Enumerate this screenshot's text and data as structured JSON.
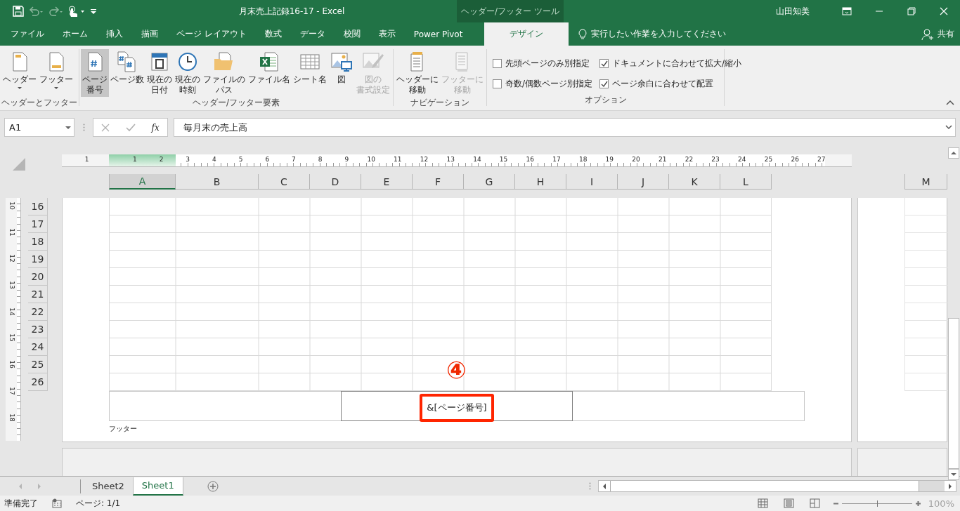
{
  "title_bar": {
    "title": "月末売上記録16-17  -  Excel",
    "context_tools": "ヘッダー/フッター ツール",
    "user": "山田知美"
  },
  "tabs": [
    {
      "label": "ファイル",
      "selected": false
    },
    {
      "label": "ホーム",
      "selected": false
    },
    {
      "label": "挿入",
      "selected": false
    },
    {
      "label": "描画",
      "selected": false
    },
    {
      "label": "ページ レイアウト",
      "selected": false
    },
    {
      "label": "数式",
      "selected": false
    },
    {
      "label": "データ",
      "selected": false
    },
    {
      "label": "校閲",
      "selected": false
    },
    {
      "label": "表示",
      "selected": false
    },
    {
      "label": "Power Pivot",
      "selected": false
    },
    {
      "label": "デザイン",
      "selected": true
    }
  ],
  "tell_me": "実行したい作業を入力してください",
  "share": "共有",
  "ribbon": {
    "groups": [
      {
        "label": "ヘッダーとフッター",
        "buttons": [
          {
            "lines": [
              "ヘッダー"
            ],
            "dropdown": true,
            "selected": false,
            "disabled": false
          },
          {
            "lines": [
              "フッター"
            ],
            "dropdown": true,
            "selected": false,
            "disabled": false
          }
        ]
      },
      {
        "label": "ヘッダー/フッター要素",
        "buttons": [
          {
            "lines": [
              "ページ",
              "番号"
            ],
            "dropdown": false,
            "selected": true,
            "disabled": false
          },
          {
            "lines": [
              "ページ数"
            ],
            "dropdown": false,
            "selected": false,
            "disabled": false
          },
          {
            "lines": [
              "現在の",
              "日付"
            ],
            "dropdown": false,
            "selected": false,
            "disabled": false
          },
          {
            "lines": [
              "現在の",
              "時刻"
            ],
            "dropdown": false,
            "selected": false,
            "disabled": false
          },
          {
            "lines": [
              "ファイルの",
              "パス"
            ],
            "dropdown": false,
            "selected": false,
            "disabled": false
          },
          {
            "lines": [
              "ファイル名"
            ],
            "dropdown": false,
            "selected": false,
            "disabled": false
          },
          {
            "lines": [
              "シート名"
            ],
            "dropdown": false,
            "selected": false,
            "disabled": false
          },
          {
            "lines": [
              "図"
            ],
            "dropdown": false,
            "selected": false,
            "disabled": false
          },
          {
            "lines": [
              "図の",
              "書式設定"
            ],
            "dropdown": false,
            "selected": false,
            "disabled": true
          }
        ]
      },
      {
        "label": "ナビゲーション",
        "buttons": [
          {
            "lines": [
              "ヘッダーに",
              "移動"
            ],
            "dropdown": false,
            "selected": false,
            "disabled": false
          },
          {
            "lines": [
              "フッターに",
              "移動"
            ],
            "dropdown": false,
            "selected": false,
            "disabled": true
          }
        ]
      },
      {
        "label": "オプション",
        "checkboxes": [
          {
            "label": "先頭ページのみ別指定",
            "checked": false
          },
          {
            "label": "奇数/偶数ページ別指定",
            "checked": false
          },
          {
            "label": "ドキュメントに合わせて拡大/縮小",
            "checked": true
          },
          {
            "label": "ページ余白に合わせて配置",
            "checked": true
          }
        ]
      }
    ]
  },
  "formula_bar": {
    "name_box": "A1",
    "function_label": "fx",
    "value": "毎月末の売上高"
  },
  "ruler": {
    "top_labels": [
      "1",
      "1",
      "2",
      "3",
      "4",
      "5",
      "6",
      "7",
      "8",
      "9",
      "10",
      "11",
      "12",
      "13",
      "14",
      "15",
      "16",
      "17",
      "18",
      "19",
      "20",
      "21",
      "22",
      "23",
      "24",
      "25",
      "26",
      "27"
    ],
    "side_labels": [
      "10",
      "11",
      "12",
      "13",
      "14",
      "15",
      "16",
      "17",
      "18"
    ]
  },
  "columns": [
    {
      "label": "A",
      "selected": true
    },
    {
      "label": "B",
      "selected": false
    },
    {
      "label": "C",
      "selected": false
    },
    {
      "label": "D",
      "selected": false
    },
    {
      "label": "E",
      "selected": false
    },
    {
      "label": "F",
      "selected": false
    },
    {
      "label": "G",
      "selected": false
    },
    {
      "label": "H",
      "selected": false
    },
    {
      "label": "I",
      "selected": false
    },
    {
      "label": "J",
      "selected": false
    },
    {
      "label": "K",
      "selected": false
    },
    {
      "label": "L",
      "selected": false
    }
  ],
  "next_page_columns": [
    {
      "label": "M",
      "selected": false
    }
  ],
  "rows": [
    {
      "label": "16"
    },
    {
      "label": "17"
    },
    {
      "label": "18"
    },
    {
      "label": "19"
    },
    {
      "label": "20"
    },
    {
      "label": "21"
    },
    {
      "label": "22"
    },
    {
      "label": "23"
    },
    {
      "label": "24"
    },
    {
      "label": "25"
    },
    {
      "label": "26"
    }
  ],
  "footer": {
    "label": "フッター",
    "center": "&[ページ番号]",
    "highlighted": true
  },
  "annotation": {
    "marker": "④"
  },
  "sheet_tabs": [
    {
      "label": "Sheet2",
      "selected": false
    },
    {
      "label": "Sheet1",
      "selected": true
    }
  ],
  "status_bar": {
    "status": "準備完了",
    "page": "ページ: 1/1",
    "zoom_slider": {
      "level": 0.5
    },
    "zoom": "100%"
  }
}
